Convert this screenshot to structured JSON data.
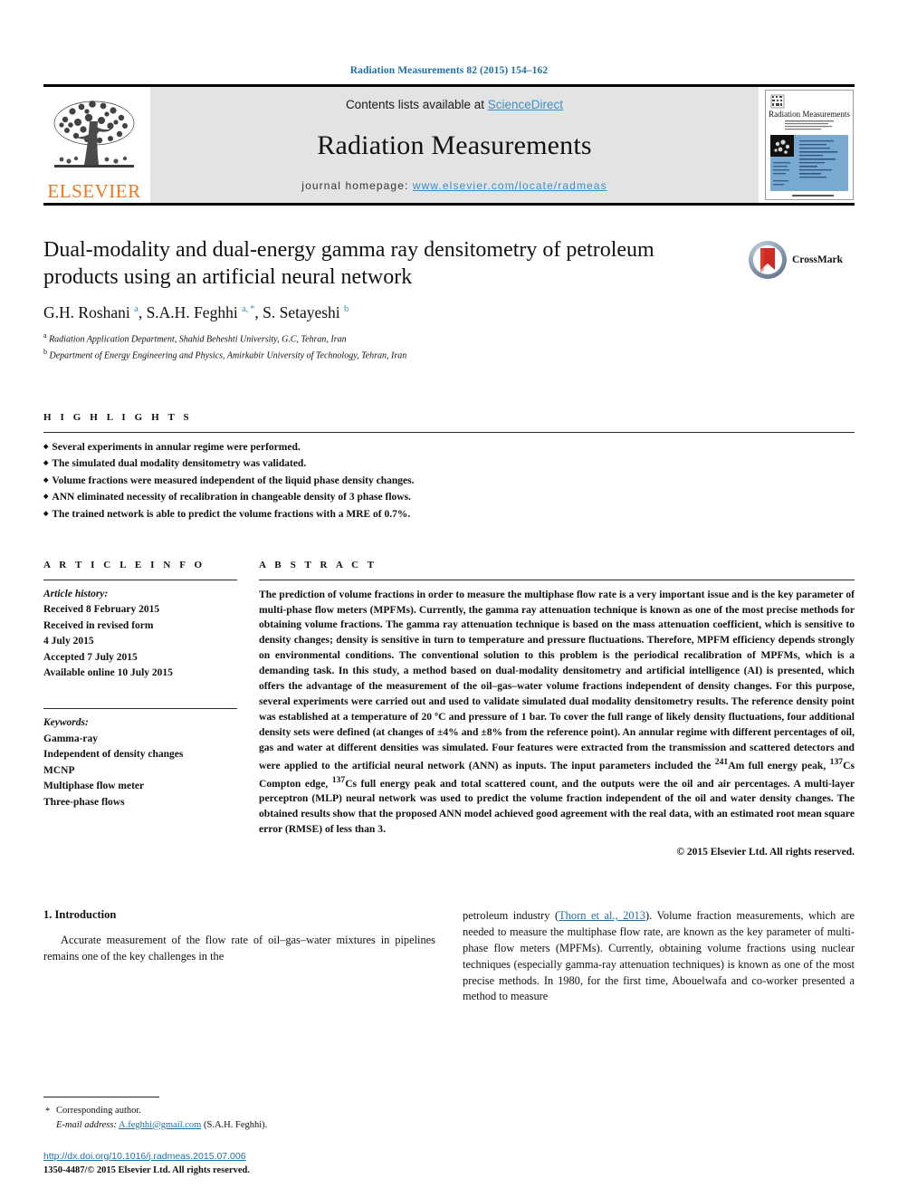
{
  "running_head": "Radiation Measurements 82 (2015) 154–162",
  "masthead": {
    "contents_prefix": "Contents lists available at ",
    "sciencedirect": "ScienceDirect",
    "journal_name": "Radiation Measurements",
    "homepage_prefix": "journal homepage: ",
    "homepage_url": "www.elsevier.com/locate/radmeas",
    "elsevier_wordmark": "ELSEVIER",
    "cover_title": "Radiation Measurements",
    "link_color": "#3c8fc4",
    "band_color": "#e3e3e3",
    "elsevier_orange": "#e87722"
  },
  "title_block": {
    "title": "Dual-modality and dual-energy gamma ray densitometry of petroleum products using an artificial neural network",
    "authors_html": "G.H. Roshani <sup>a</sup>, S.A.H. Feghhi <sup>a, *</sup>, S. Setayeshi <sup>b</sup>",
    "affiliations": [
      {
        "marker": "a",
        "text": "Radiation Application Department, Shahid Beheshti University, G.C, Tehran, Iran"
      },
      {
        "marker": "b",
        "text": "Department of Energy Engineering and Physics, Amirkabir University of Technology, Tehran, Iran"
      }
    ],
    "crossmark_label": "CrossMark"
  },
  "highlights": {
    "heading": "H I G H L I G H T S",
    "items": [
      "Several experiments in annular regime were performed.",
      "The simulated dual modality densitometry was validated.",
      "Volume fractions were measured independent of the liquid phase density changes.",
      "ANN eliminated necessity of recalibration in changeable density of 3 phase flows.",
      "The trained network is able to predict the volume fractions with a MRE of 0.7%."
    ]
  },
  "article_info": {
    "heading": "A R T I C L E   I N F O",
    "history_label": "Article history:",
    "history_lines": [
      "Received 8 February 2015",
      "Received in revised form",
      "4 July 2015",
      "Accepted 7 July 2015",
      "Available online 10 July 2015"
    ],
    "keywords_label": "Keywords:",
    "keywords": [
      "Gamma-ray",
      "Independent of density changes",
      "MCNP",
      "Multiphase flow meter",
      "Three-phase flows"
    ]
  },
  "abstract": {
    "heading": "A B S T R A C T",
    "text_html": "The prediction of volume fractions in order to measure the multiphase flow rate is a very important issue and is the key parameter of multi-phase flow meters (MPFMs). Currently, the gamma ray attenuation technique is known as one of the most precise methods for obtaining volume fractions. The gamma ray attenuation technique is based on the mass attenuation coefficient, which is sensitive to density changes; density is sensitive in turn to temperature and pressure fluctuations. Therefore, MPFM efficiency depends strongly on environmental conditions. The conventional solution to this problem is the periodical recalibration of MPFMs, which is a demanding task. In this study, a method based on dual-modality densitometry and artificial intelligence (AI) is presented, which offers the advantage of the measurement of the oil&#8211;gas&#8211;water volume fractions independent of density changes. For this purpose, several experiments were carried out and used to validate simulated dual modality densitometry results. The reference density point was established at a temperature of 20 &#186;C and pressure of 1 bar. To cover the full range of likely density fluctuations, four additional density sets were defined (at changes of &#177;4% and &#177;8% from the reference point). An annular regime with different percentages of oil, gas and water at different densities was simulated. Four features were extracted from the transmission and scattered detectors and were applied to the artificial neural network (ANN) as inputs. The input parameters included the <sup>241</sup>Am full energy peak, <sup>137</sup>Cs Compton edge, <sup>137</sup>Cs full energy peak and total scattered count, and the outputs were the oil and air percentages. A multi-layer perceptron (MLP) neural network was used to predict the volume fraction independent of the oil and water density changes. The obtained results show that the proposed ANN model achieved good agreement with the real data, with an estimated root mean square error (RMSE) of less than 3.",
    "copyright": "© 2015 Elsevier Ltd. All rights reserved."
  },
  "body": {
    "section_number_title": "1. Introduction",
    "left_paragraph": "Accurate measurement of the flow rate of oil–gas–water mixtures in pipelines remains one of the key challenges in the",
    "right_paragraph_prefix": "petroleum industry (",
    "right_citation": "Thorn et al., 2013",
    "right_paragraph_suffix": "). Volume fraction measurements, which are needed to measure the multiphase flow rate, are known as the key parameter of multi-phase flow meters (MPFMs). Currently, obtaining volume fractions using nuclear techniques (especially gamma-ray attenuation techniques) is known as one of the most precise methods. In 1980, for the first time, Abouelwafa and co-worker presented a method to measure"
  },
  "footnote": {
    "star": "*",
    "corresponding": "Corresponding author.",
    "email_label": "E-mail address:",
    "email": "A.feghhi@gmail.com",
    "email_owner": "(S.A.H. Feghhi).",
    "doi": "http://dx.doi.org/10.1016/j.radmeas.2015.07.006",
    "issn_line": "1350-4487/© 2015 Elsevier Ltd. All rights reserved."
  }
}
